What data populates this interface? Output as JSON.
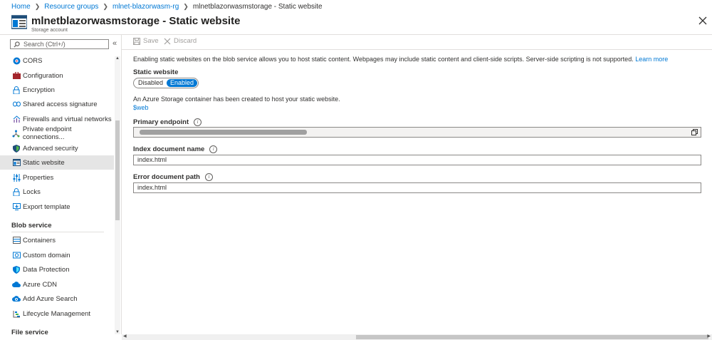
{
  "breadcrumb": [
    "Home",
    "Resource groups",
    "mlnet-blazorwasm-rg",
    "mlnetblazorwasmstorage - Static website"
  ],
  "header": {
    "title": "mlnetblazorwasmstorage - Static website",
    "subtitle": "Storage account"
  },
  "search": {
    "placeholder": "Search (Ctrl+/)"
  },
  "sidebar": {
    "items": [
      {
        "label": "CORS",
        "icon": "cors-icon"
      },
      {
        "label": "Configuration",
        "icon": "briefcase-icon"
      },
      {
        "label": "Encryption",
        "icon": "lock-icon"
      },
      {
        "label": "Shared access signature",
        "icon": "link-icon"
      },
      {
        "label": "Firewalls and virtual networks",
        "icon": "firewall-icon"
      },
      {
        "label": "Private endpoint connections...",
        "icon": "endpoint-icon"
      },
      {
        "label": "Advanced security",
        "icon": "shield-icon"
      },
      {
        "label": "Static website",
        "icon": "static-website-icon",
        "active": true
      },
      {
        "label": "Properties",
        "icon": "sliders-icon"
      },
      {
        "label": "Locks",
        "icon": "lock-icon"
      },
      {
        "label": "Export template",
        "icon": "export-icon"
      }
    ],
    "sections": [
      {
        "title": "Blob service",
        "items": [
          {
            "label": "Containers",
            "icon": "containers-icon"
          },
          {
            "label": "Custom domain",
            "icon": "globe-icon"
          },
          {
            "label": "Data Protection",
            "icon": "shield-icon"
          },
          {
            "label": "Azure CDN",
            "icon": "cloud-icon"
          },
          {
            "label": "Add Azure Search",
            "icon": "cloud-search-icon"
          },
          {
            "label": "Lifecycle Management",
            "icon": "lifecycle-icon"
          }
        ]
      },
      {
        "title": "File service",
        "items": []
      }
    ]
  },
  "toolbar": {
    "save_label": "Save",
    "discard_label": "Discard"
  },
  "main": {
    "intro": "Enabling static websites on the blob service allows you to host static content. Webpages may include static content and client-side scripts. Server-side scripting is not supported.",
    "learn_more": "Learn more",
    "static_website_label": "Static website",
    "toggle": {
      "disabled": "Disabled",
      "enabled": "Enabled",
      "selected": "Enabled"
    },
    "container_note": "An Azure Storage container has been created to host your static website.",
    "container_link": "$web",
    "primary_endpoint_label": "Primary endpoint",
    "index_doc_label": "Index document name",
    "index_doc_value": "index.html",
    "error_doc_label": "Error document path",
    "error_doc_value": "index.html"
  },
  "colors": {
    "accent": "#0078d4",
    "active_nav": "#e5e5e5"
  }
}
